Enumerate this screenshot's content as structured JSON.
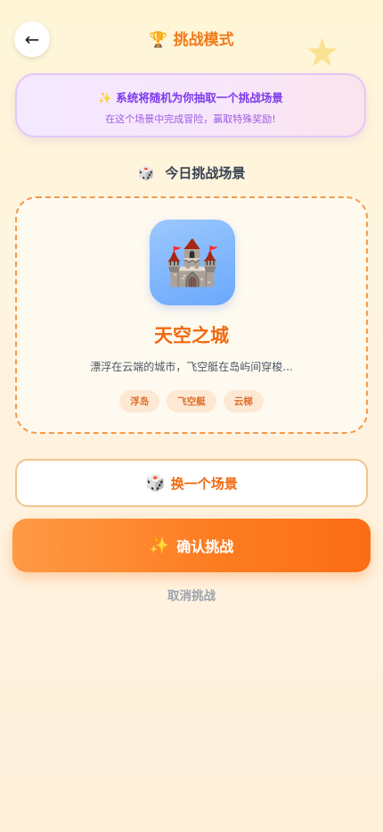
{
  "header": {
    "back_icon": "←",
    "title_icon": "🏆",
    "title": "挑战模式",
    "decor_icon": "★"
  },
  "notice": {
    "icon": "✨",
    "title": "系统将随机为你抽取一个挑战场景",
    "subtitle": "在这个场景中完成冒险，赢取特殊奖励!"
  },
  "section": {
    "icon": "🎲",
    "title": "今日挑战场景"
  },
  "scene": {
    "icon": "🏰",
    "name": "天空之城",
    "description": "漂浮在云端的城市，飞空艇在岛屿间穿梭...",
    "tags": [
      "浮岛",
      "飞空艇",
      "云梯"
    ]
  },
  "actions": {
    "swap_icon": "🎲",
    "swap_label": "换一个场景",
    "confirm_icon": "✨",
    "confirm_label": "确认挑战",
    "cancel_label": "取消挑战"
  },
  "colors": {
    "accent": "#f06a0f",
    "notice_text": "#7c3aed",
    "dashed_border": "#f59a4a"
  }
}
